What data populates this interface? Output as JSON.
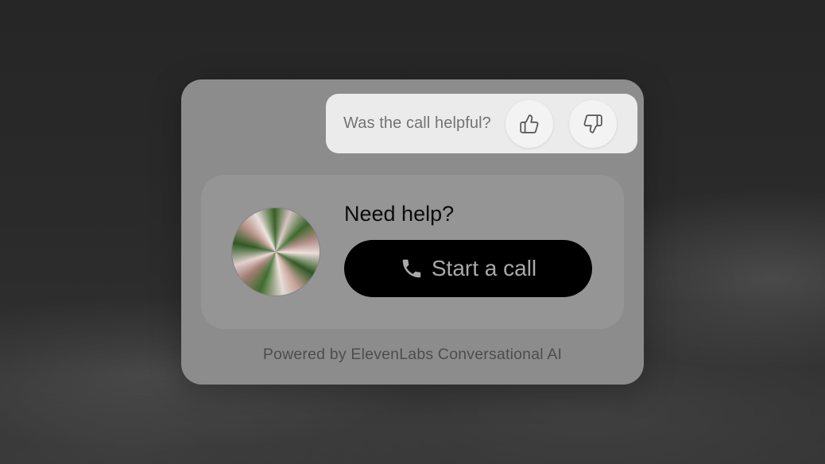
{
  "feedback": {
    "question": "Was the call helpful?",
    "thumbs_up_icon": "thumbs-up-icon",
    "thumbs_down_icon": "thumbs-down-icon"
  },
  "card": {
    "title": "Need help?",
    "avatar": "agent-orb",
    "call_button_label": "Start a call",
    "call_button_icon": "phone-icon"
  },
  "footer": {
    "text": "Powered by ElevenLabs Conversational AI"
  },
  "colors": {
    "widget_background": "#8c8c8c",
    "card_background": "#959595",
    "feedback_background": "#ebebeb",
    "call_button_background": "#000000",
    "call_button_text": "#a9a9a9"
  }
}
